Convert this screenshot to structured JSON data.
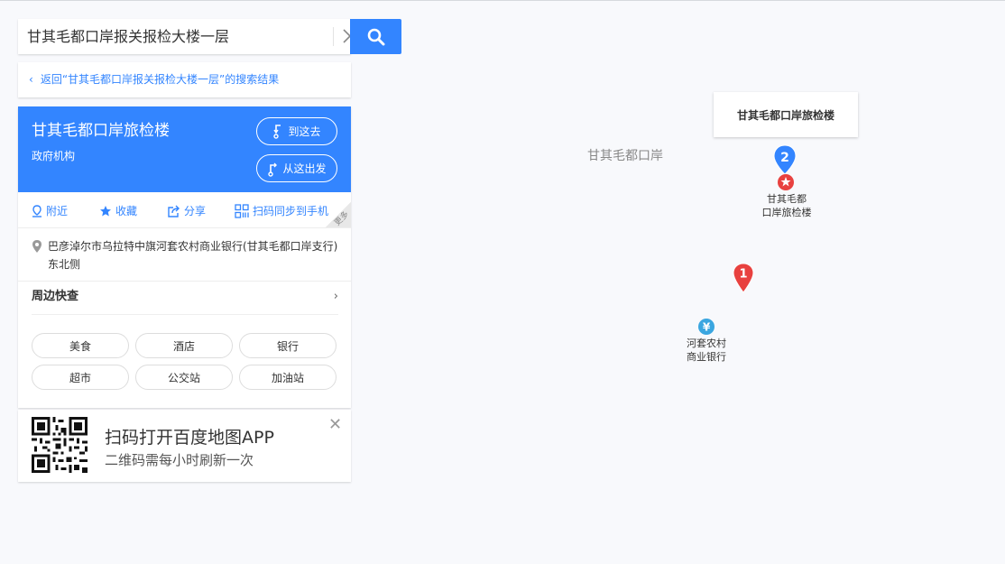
{
  "search": {
    "query": "甘其毛都口岸报关报检大楼一层"
  },
  "back": {
    "label": "返回“甘其毛都口岸报关报检大楼一层”的搜索结果"
  },
  "poi": {
    "name": "甘其毛都口岸旅检楼",
    "category": "政府机构",
    "go_here": "到这去",
    "from_here": "从这出发",
    "actions": {
      "nearby": "附近",
      "favorite": "收藏",
      "share": "分享",
      "sync": "扫码同步到手机",
      "more": "更多"
    },
    "address": "巴彦淖尔市乌拉特中旗河套农村商业银行(甘其毛都口岸支行)东北侧",
    "nearby_title": "周边快查",
    "nearby_tags": [
      "美食",
      "酒店",
      "银行",
      "超市",
      "公交站",
      "加油站"
    ]
  },
  "promo": {
    "title": "扫码打开百度地图APP",
    "subtitle": "二维码需每小时刷新一次"
  },
  "map": {
    "area_label": "甘其毛都口岸",
    "info_box": "甘其毛都口岸旅检楼",
    "markers": [
      {
        "number": "1"
      },
      {
        "number": "2"
      }
    ],
    "poi_main": "甘其毛都\n口岸旅检楼",
    "poi_bank": "河套农村\n商业银行",
    "bank_glyph": "¥"
  },
  "colors": {
    "accent": "#3385ff",
    "marker_red": "#e8413f",
    "marker_blue": "#3385ff"
  }
}
